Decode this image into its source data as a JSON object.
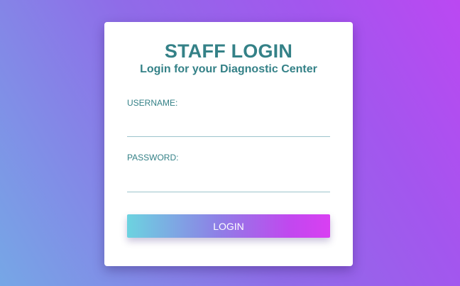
{
  "login": {
    "title": "STAFF LOGIN",
    "subtitle": "Login for your Diagnostic Center",
    "username_label": "USERNAME:",
    "username_value": "",
    "password_label": "PASSWORD:",
    "password_value": "",
    "button_label": "LOGIN"
  },
  "colors": {
    "accent": "#348187",
    "gradient_start": "#6cd3e0",
    "gradient_end": "#d93ff2"
  }
}
